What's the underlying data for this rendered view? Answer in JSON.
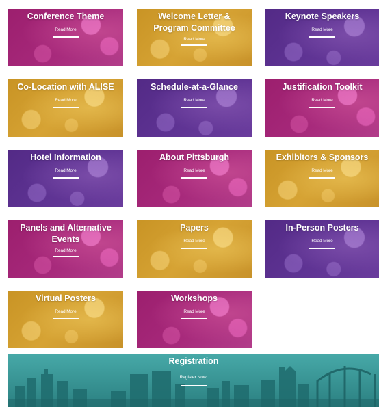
{
  "tiles": [
    {
      "title": "Conference Theme",
      "link": "Read More",
      "color": "#a6287a"
    },
    {
      "title": "Welcome Letter & Program Committee",
      "link": "Read More",
      "color": "#d6a334"
    },
    {
      "title": "Keynote Speakers",
      "link": "Read More",
      "color": "#5e3393"
    },
    {
      "title": "Co-Location with ALISE",
      "link": "Read More",
      "color": "#d6a334"
    },
    {
      "title": "Schedule-at-a-Glance",
      "link": "Read More",
      "color": "#5e3393"
    },
    {
      "title": "Justification Toolkit",
      "link": "Read More",
      "color": "#a6287a"
    },
    {
      "title": "Hotel Information",
      "link": "Read More",
      "color": "#5e3393"
    },
    {
      "title": "About Pittsburgh",
      "link": "Read More",
      "color": "#a6287a"
    },
    {
      "title": "Exhibitors & Sponsors",
      "link": "Read More",
      "color": "#d6a334"
    },
    {
      "title": "Panels and Alternative Events",
      "link": "Read More",
      "color": "#a6287a"
    },
    {
      "title": "Papers",
      "link": "Read More",
      "color": "#d6a334"
    },
    {
      "title": "In-Person Posters",
      "link": "Read More",
      "color": "#5e3393"
    },
    {
      "title": "Virtual Posters",
      "link": "Read More",
      "color": "#d6a334"
    },
    {
      "title": "Workshops",
      "link": "Read More",
      "color": "#a6287a"
    }
  ],
  "registration": {
    "title": "Registration",
    "link": "Register Now!",
    "color": "#3b9b9c"
  }
}
